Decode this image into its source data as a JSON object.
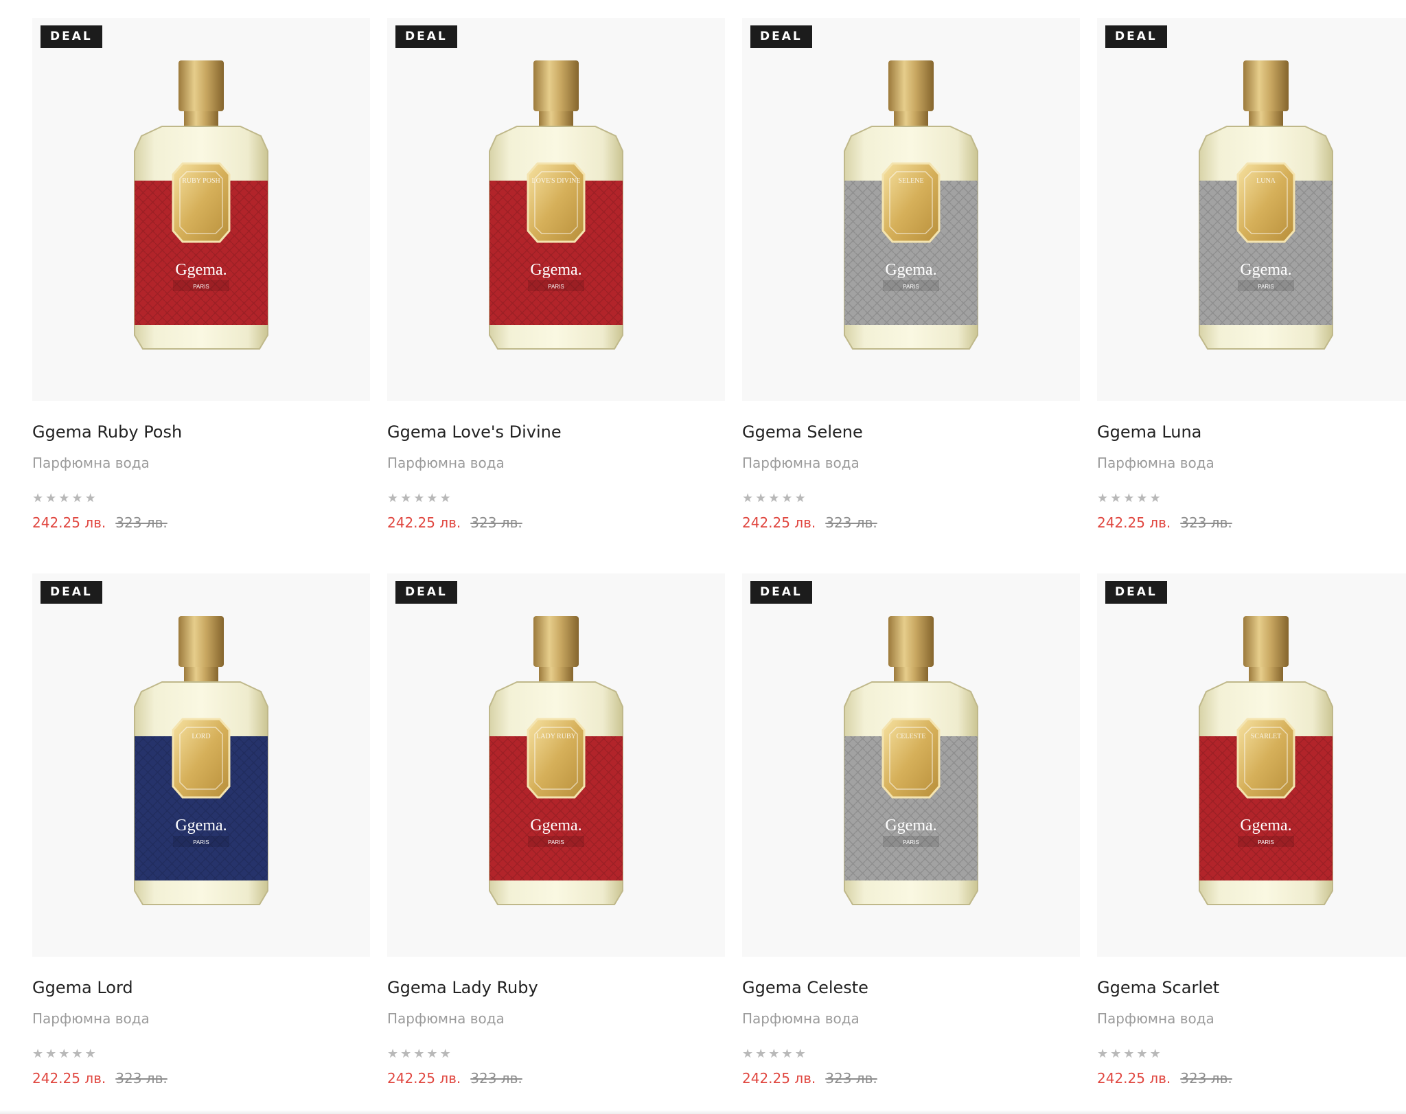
{
  "colors": {
    "price_now": "#e0463f",
    "price_old": "#8d8d8d",
    "badge_bg": "#1c1c1c",
    "card_bg": "#f8f8f8",
    "label_red": "#b2242a",
    "label_gray": "#a2a2a2",
    "label_navy": "#26336b"
  },
  "products": [
    {
      "badge": "DEAL",
      "title": "Ggema Ruby Posh",
      "subtitle": "Парфюмна вода",
      "price": "242.25 лв.",
      "old_price": "323 лв.",
      "label_color": "red",
      "stars": 0,
      "cartouche": "RUBY POSH",
      "brand": "Ggema.",
      "brand_sub": "PARIS"
    },
    {
      "badge": "DEAL",
      "title": "Ggema Love's Divine",
      "subtitle": "Парфюмна вода",
      "price": "242.25 лв.",
      "old_price": "323 лв.",
      "label_color": "red",
      "stars": 0,
      "cartouche": "LOVE'S DIVINE",
      "brand": "Ggema.",
      "brand_sub": "PARIS"
    },
    {
      "badge": "DEAL",
      "title": "Ggema Selene",
      "subtitle": "Парфюмна вода",
      "price": "242.25 лв.",
      "old_price": "323 лв.",
      "label_color": "gray",
      "stars": 0,
      "cartouche": "SELENE",
      "brand": "Ggema.",
      "brand_sub": "PARIS"
    },
    {
      "badge": "DEAL",
      "title": "Ggema Luna",
      "subtitle": "Парфюмна вода",
      "price": "242.25 лв.",
      "old_price": "323 лв.",
      "label_color": "gray",
      "stars": 0,
      "cartouche": "LUNA",
      "brand": "Ggema.",
      "brand_sub": "PARIS"
    },
    {
      "badge": "DEAL",
      "title": "Ggema Lord",
      "subtitle": "Парфюмна вода",
      "price": "242.25 лв.",
      "old_price": "323 лв.",
      "label_color": "navy",
      "stars": 0,
      "cartouche": "LORD",
      "brand": "Ggema.",
      "brand_sub": "PARIS"
    },
    {
      "badge": "DEAL",
      "title": "Ggema Lady Ruby",
      "subtitle": "Парфюмна вода",
      "price": "242.25 лв.",
      "old_price": "323 лв.",
      "label_color": "red",
      "stars": 0,
      "cartouche": "LADY RUBY",
      "brand": "Ggema.",
      "brand_sub": "PARIS"
    },
    {
      "badge": "DEAL",
      "title": "Ggema Celeste",
      "subtitle": "Парфюмна вода",
      "price": "242.25 лв.",
      "old_price": "323 лв.",
      "label_color": "gray",
      "stars": 0,
      "cartouche": "CELESTE",
      "brand": "Ggema.",
      "brand_sub": "PARIS"
    },
    {
      "badge": "DEAL",
      "title": "Ggema Scarlet",
      "subtitle": "Парфюмна вода",
      "price": "242.25 лв.",
      "old_price": "323 лв.",
      "label_color": "red",
      "stars": 0,
      "cartouche": "SCARLET",
      "brand": "Ggema.",
      "brand_sub": "PARIS"
    }
  ]
}
